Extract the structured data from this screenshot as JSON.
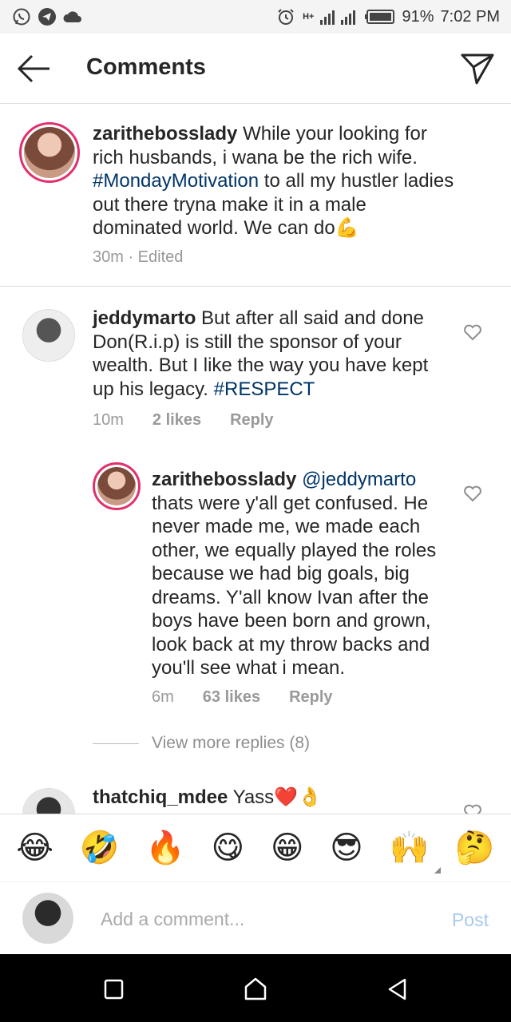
{
  "status_bar": {
    "net": "H+",
    "battery": "91%",
    "time": "7:02 PM"
  },
  "header": {
    "title": "Comments"
  },
  "caption": {
    "username": "zarithebosslady",
    "text_before": " While your looking for rich husbands, i wana be the rich wife. ",
    "hashtag": "#MondayMotivation",
    "text_after": " to all my hustler ladies out there tryna make it in a male dominated world. We can do",
    "emoji": "💪",
    "time": "30m",
    "edited": " · Edited"
  },
  "comments": [
    {
      "username": "jeddymarto",
      "text": " But after all said and done Don(R.i.p) is still the sponsor of your wealth. But I like the way you have kept up his legacy. ",
      "hashtag": "#RESPECT",
      "time": "10m",
      "likes": "2 likes",
      "reply": "Reply"
    },
    {
      "username": "zarithebosslady",
      "mention": "@jeddymarto",
      "text": " thats were y'all get confused. He never made me, we made each other, we equally played the roles because we had big goals, big dreams. Y'all know Ivan after the boys have been born and grown, look back at my throw backs and you'll see what i mean.",
      "time": "6m",
      "likes": "63 likes",
      "reply": "Reply"
    },
    {
      "username": "thatchiq_mdee",
      "text": " Yass",
      "emoji": "❤️👌"
    }
  ],
  "view_more": "View more replies (8)",
  "emoji_bar": [
    "😂",
    "🤣",
    "🔥",
    "😋",
    "😁",
    "😎",
    "🙌",
    "🤔"
  ],
  "composer": {
    "placeholder": "Add a comment...",
    "post_label": "Post"
  },
  "colors": {
    "hashtag": "#003569",
    "story_ring": "#e1306c",
    "post_disabled": "#a8c8ee",
    "meta": "#999999"
  },
  "icons": [
    "whatsapp-icon",
    "telegram-icon",
    "cloud-icon",
    "alarm-icon",
    "signal-icon",
    "battery-icon",
    "back-arrow-icon",
    "direct-message-icon",
    "heart-icon",
    "square-icon",
    "home-circle-icon",
    "back-triangle-icon"
  ]
}
